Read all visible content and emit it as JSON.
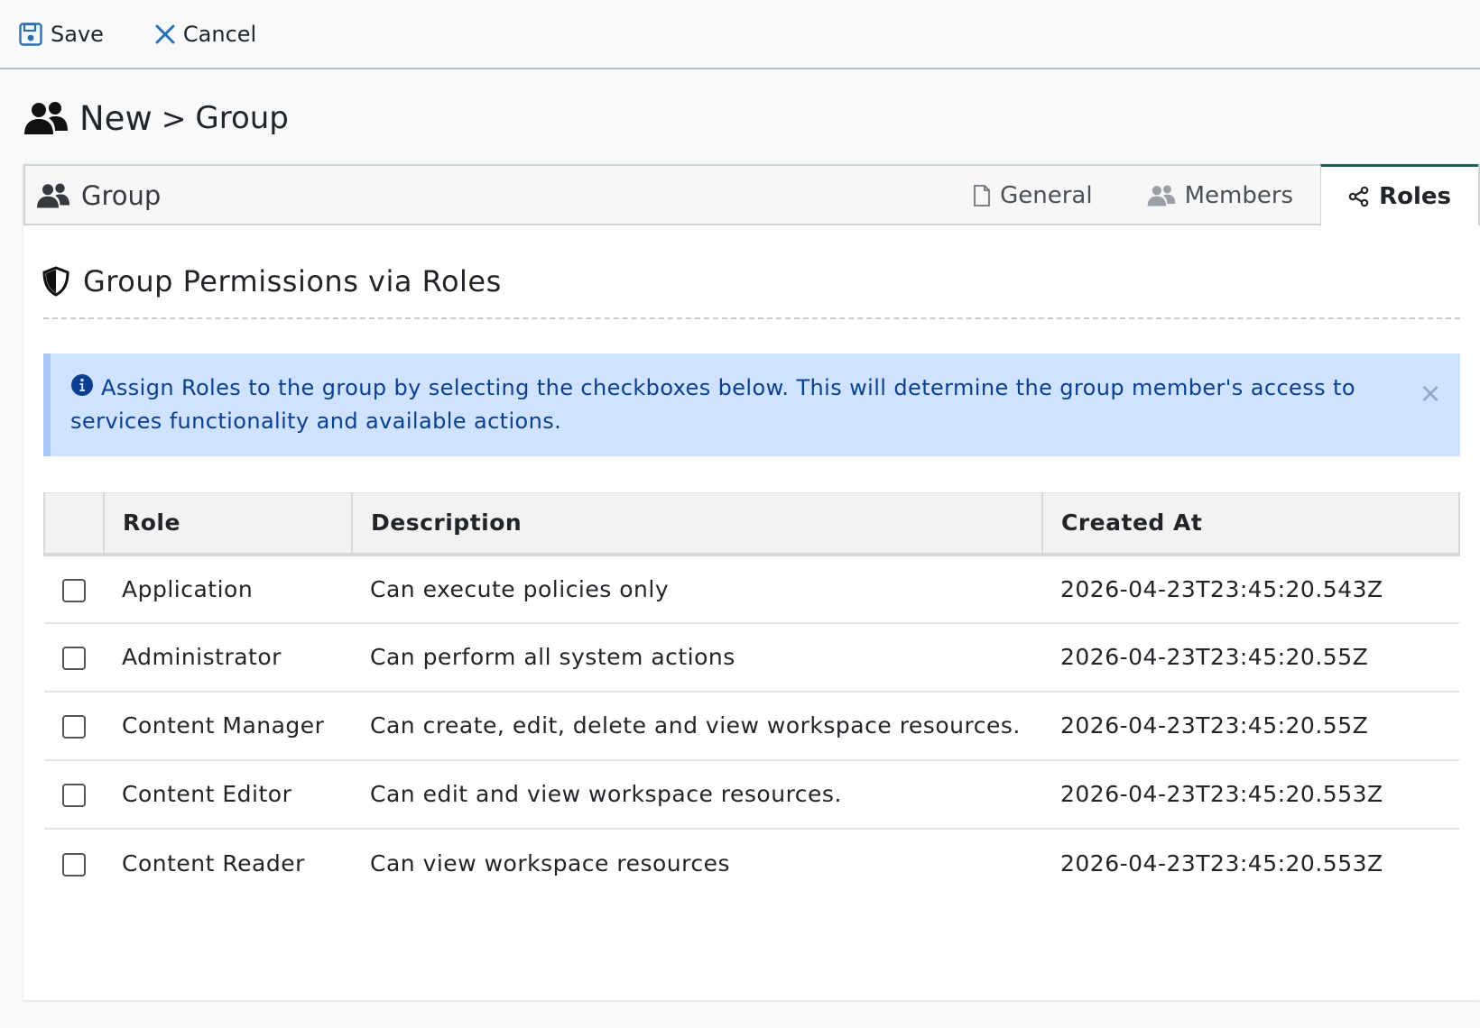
{
  "toolbar": {
    "save_label": "Save",
    "cancel_label": "Cancel"
  },
  "breadcrumb": {
    "first": "New",
    "separator": ">",
    "second": "Group"
  },
  "card": {
    "header_title": "Group",
    "tabs": [
      {
        "label": "General",
        "icon": "file-icon",
        "active": false
      },
      {
        "label": "Members",
        "icon": "users-icon",
        "active": false
      },
      {
        "label": "Roles",
        "icon": "share-nodes-icon",
        "active": true
      }
    ]
  },
  "section": {
    "title": "Group Permissions via Roles"
  },
  "alert": {
    "text": "Assign Roles to the group by selecting the checkboxes below. This will determine the group member's access to services functionality and available actions.",
    "close": "×"
  },
  "table": {
    "headers": [
      "Role",
      "Description",
      "Created At"
    ],
    "rows": [
      {
        "role": "Application",
        "description": "Can execute policies only",
        "created_at": "2026-04-23T23:45:20.543Z",
        "checked": false
      },
      {
        "role": "Administrator",
        "description": "Can perform all system actions",
        "created_at": "2026-04-23T23:45:20.55Z",
        "checked": false
      },
      {
        "role": "Content Manager",
        "description": "Can create, edit, delete and view workspace resources.",
        "created_at": "2026-04-23T23:45:20.55Z",
        "checked": false
      },
      {
        "role": "Content Editor",
        "description": "Can edit and view workspace resources.",
        "created_at": "2026-04-23T23:45:20.553Z",
        "checked": false
      },
      {
        "role": "Content Reader",
        "description": "Can view workspace resources",
        "created_at": "2026-04-23T23:45:20.553Z",
        "checked": false
      }
    ]
  },
  "colors": {
    "accent_tab": "#1c5e58",
    "alert_bg": "#cfe2ff",
    "alert_text": "#0b3f8f",
    "save_icon": "#2a6fb0",
    "cancel_icon": "#2a6fb0"
  }
}
